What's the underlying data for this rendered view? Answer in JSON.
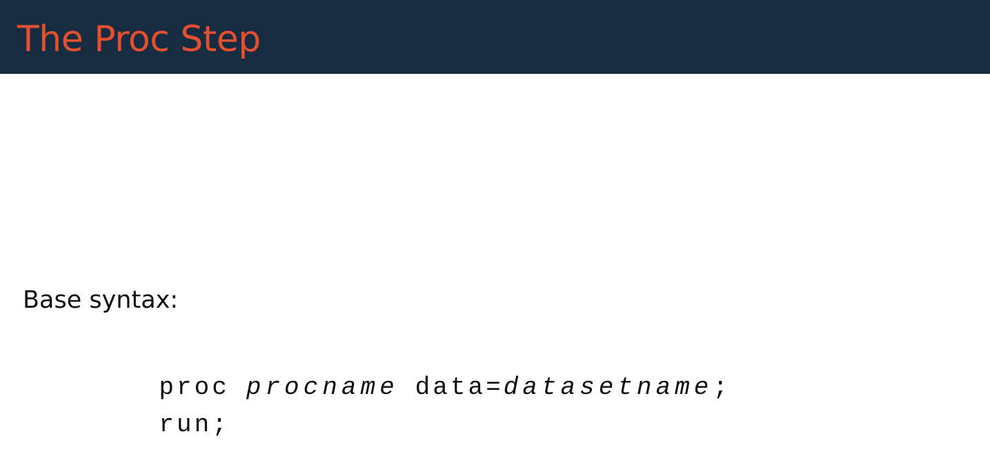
{
  "slide": {
    "title": "The Proc Step",
    "intro_text": "Base syntax:"
  },
  "code": {
    "line1": {
      "keyword": "proc",
      "placeholder_proc": "procname",
      "option": "data=",
      "placeholder_dataset": "datasetname",
      "terminator": ";"
    },
    "line2": {
      "statement": "run;"
    }
  },
  "colors": {
    "title_bar_background": "#172b41",
    "title_text": "#e4502f",
    "body_text": "#111111",
    "page_background": "#ffffff"
  }
}
